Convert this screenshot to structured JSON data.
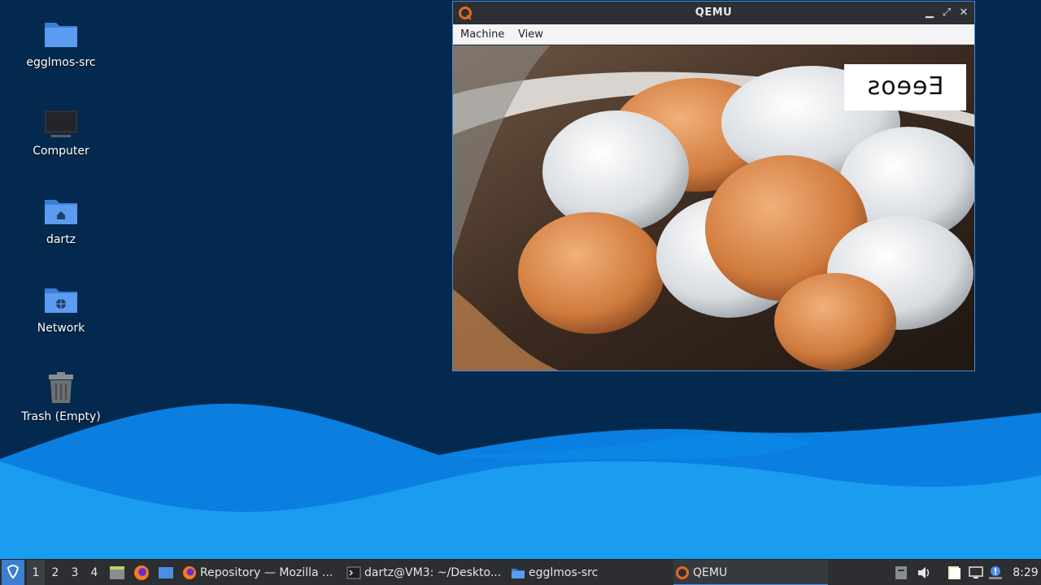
{
  "desktop": {
    "icons": [
      {
        "label": "egglmos-src",
        "icon": "folder-icon"
      },
      {
        "label": "Computer",
        "icon": "computer-icon"
      },
      {
        "label": "dartz",
        "icon": "home-folder-icon"
      },
      {
        "label": "Network",
        "icon": "network-folder-icon"
      },
      {
        "label": "Trash (Empty)",
        "icon": "trash-icon"
      }
    ]
  },
  "qemu_window": {
    "title": "QEMU",
    "menus": [
      "Machine",
      "View"
    ],
    "controls": [
      "minimize-icon",
      "maximize-icon",
      "close-icon"
    ],
    "guest_screen": {
      "description_icon": "eggs-photo",
      "osd_text": "Eeeos"
    }
  },
  "panel": {
    "workspaces": [
      "1",
      "2",
      "3",
      "4"
    ],
    "active_workspace": "1",
    "launchers": [
      "file-manager-icon",
      "firefox-icon",
      "show-desktop-icon"
    ],
    "tasks": [
      {
        "label": "Repository — Mozilla ...",
        "icon": "firefox-icon"
      },
      {
        "label": "dartz@VM3: ~/Deskto...",
        "icon": "terminal-icon"
      },
      {
        "label": "egglmos-src",
        "icon": "folder-icon"
      },
      {
        "label": "QEMU",
        "icon": "qemu-icon"
      }
    ],
    "active_task": "QEMU",
    "tray": [
      "clipboard-icon",
      "volume-icon",
      "files-icon",
      "network-monitor-icon",
      "update-notifier-icon"
    ],
    "clock": "8:29"
  },
  "colors": {
    "desktop_bg": "#04294f",
    "wave_light": "#1a9cf0",
    "wave_mid": "#0a7fe0",
    "panel_bg": "#2c2e31",
    "window_border": "#4a8ad8",
    "folder_blue": "#4a8fe0"
  }
}
